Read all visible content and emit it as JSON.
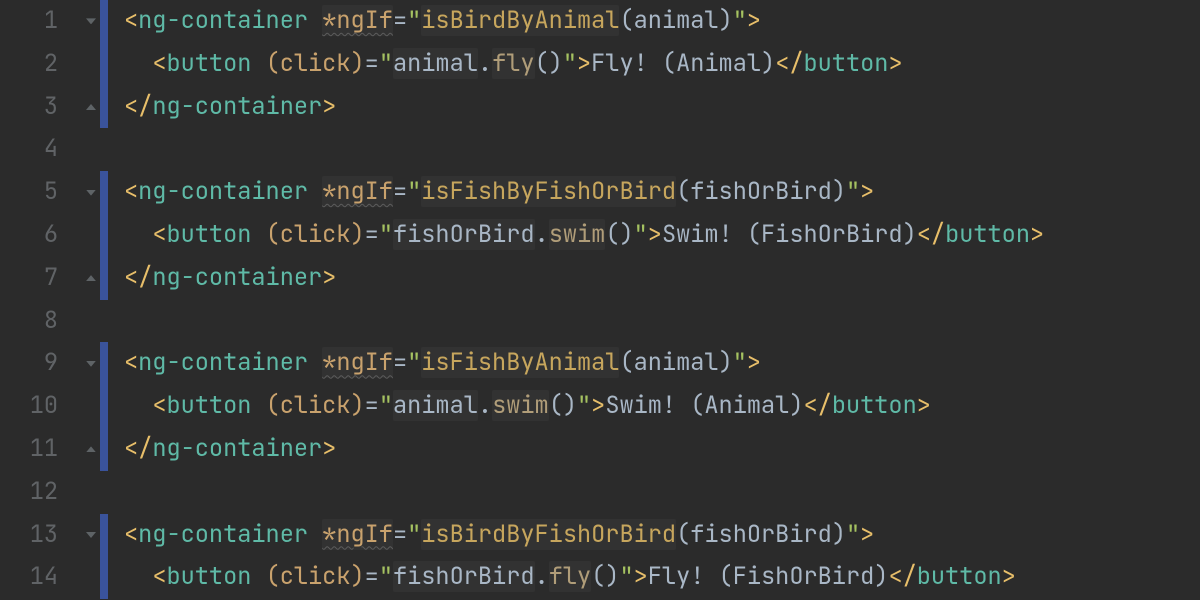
{
  "gutter": {
    "start": 1,
    "end": 14
  },
  "lines": {
    "l1": {
      "tag": "ng-container",
      "dir": "*ngIf",
      "func": "isBirdByAnimal",
      "arg": "animal"
    },
    "l2": {
      "tag": "button",
      "dir": "(click)",
      "obj": "animal",
      "method": "fly",
      "text": "Fly! (Animal)",
      "close": "button"
    },
    "l3": {
      "closetag": "ng-container"
    },
    "l5": {
      "tag": "ng-container",
      "dir": "*ngIf",
      "func": "isFishByFishOrBird",
      "arg": "fishOrBird"
    },
    "l6": {
      "tag": "button",
      "dir": "(click)",
      "obj": "fishOrBird",
      "method": "swim",
      "text": "Swim! (FishOrBird)",
      "close": "button"
    },
    "l7": {
      "closetag": "ng-container"
    },
    "l9": {
      "tag": "ng-container",
      "dir": "*ngIf",
      "func": "isFishByAnimal",
      "arg": "animal"
    },
    "l10": {
      "tag": "button",
      "dir": "(click)",
      "obj": "animal",
      "method": "swim",
      "text": "Swim! (Animal)",
      "close": "button"
    },
    "l11": {
      "closetag": "ng-container"
    },
    "l13": {
      "tag": "ng-container",
      "dir": "*ngIf",
      "func": "isBirdByFishOrBird",
      "arg": "fishOrBird"
    },
    "l14": {
      "tag": "button",
      "dir": "(click)",
      "obj": "fishOrBird",
      "method": "fly",
      "text": "Fly! (FishOrBird)",
      "close": "button"
    }
  }
}
